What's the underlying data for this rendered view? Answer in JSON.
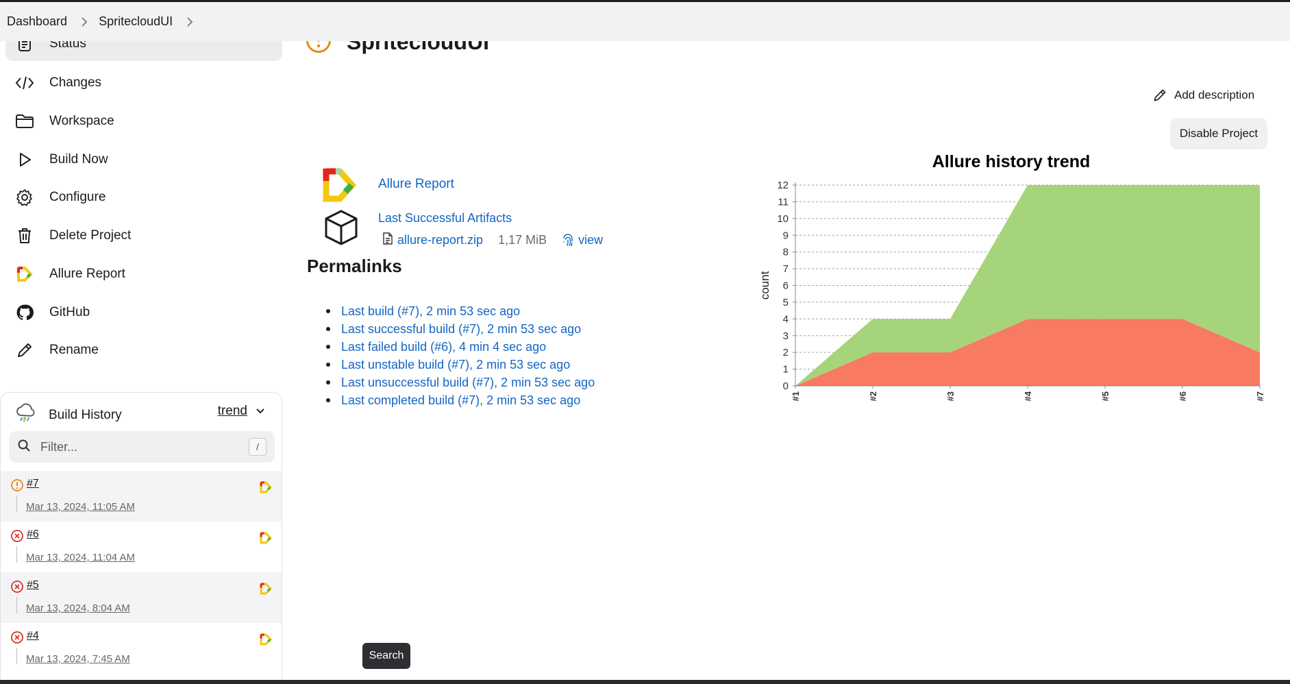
{
  "breadcrumb": {
    "items": [
      "Dashboard",
      "SpritecloudUI"
    ]
  },
  "sidebar": {
    "items": [
      {
        "label": "Status",
        "icon": "document-icon"
      },
      {
        "label": "Changes",
        "icon": "code-icon"
      },
      {
        "label": "Workspace",
        "icon": "folder-icon"
      },
      {
        "label": "Build Now",
        "icon": "play-icon"
      },
      {
        "label": "Configure",
        "icon": "gear-icon"
      },
      {
        "label": "Delete Project",
        "icon": "trash-icon"
      },
      {
        "label": "Allure Report",
        "icon": "allure-icon"
      },
      {
        "label": "GitHub",
        "icon": "github-icon"
      },
      {
        "label": "Rename",
        "icon": "pencil-icon"
      }
    ]
  },
  "build_history": {
    "title": "Build History",
    "trend_label": "trend",
    "filter_placeholder": "Filter...",
    "filter_shortcut": "/",
    "builds": [
      {
        "number": "#7",
        "date": "Mar 13, 2024, 11:05 AM",
        "status": "unstable"
      },
      {
        "number": "#6",
        "date": "Mar 13, 2024, 11:04 AM",
        "status": "failed"
      },
      {
        "number": "#5",
        "date": "Mar 13, 2024, 8:04 AM",
        "status": "failed"
      },
      {
        "number": "#4",
        "date": "Mar 13, 2024, 7:45 AM",
        "status": "failed"
      }
    ]
  },
  "main": {
    "title": "SpritecloudUI",
    "add_description": "Add description",
    "disable_project": "Disable Project",
    "allure_report_link": "Allure Report",
    "artifacts": {
      "title": "Last Successful Artifacts",
      "file_name": "allure-report.zip",
      "file_size": "1,17 MiB",
      "view_label": "view"
    },
    "permalinks_heading": "Permalinks",
    "permalinks": [
      "Last build (#7), 2 min 53 sec ago",
      "Last successful build (#7), 2 min 53 sec ago",
      "Last failed build (#6), 4 min 4 sec ago",
      "Last unstable build (#7), 2 min 53 sec ago",
      "Last unsuccessful build (#7), 2 min 53 sec ago",
      "Last completed build (#7), 2 min 53 sec ago"
    ]
  },
  "tooltip": "Search",
  "colors": {
    "unstable": "#e8890c",
    "failed": "#d9342b",
    "link": "#1365c4",
    "passed_area": "#a6d47a",
    "failed_area": "#f87a62"
  },
  "chart_data": {
    "type": "area",
    "title": "Allure history trend",
    "xlabel": "",
    "ylabel": "count",
    "categories": [
      "#1",
      "#2",
      "#3",
      "#4",
      "#5",
      "#6",
      "#7"
    ],
    "ylim": [
      0,
      12
    ],
    "yticks": [
      0,
      1,
      2,
      3,
      4,
      5,
      6,
      7,
      8,
      9,
      10,
      11,
      12
    ],
    "grid": true,
    "stacked": true,
    "series": [
      {
        "values": [
          0,
          2,
          2,
          4,
          4,
          4,
          2
        ],
        "color": "#f87a62"
      },
      {
        "values": [
          0,
          2,
          2,
          8,
          8,
          8,
          10
        ],
        "color": "#a6d47a"
      }
    ]
  }
}
